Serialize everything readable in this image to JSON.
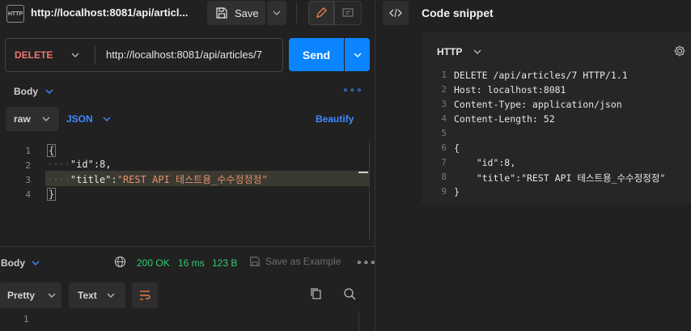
{
  "tab": {
    "title": "http://localhost:8081/api/articl...",
    "icon_text": "HTTP"
  },
  "toolbar": {
    "save_label": "Save"
  },
  "request": {
    "method": "DELETE",
    "url": "http://localhost:8081/api/articles/7",
    "send_label": "Send"
  },
  "body_section": {
    "tab_label": "Body",
    "mode": "raw",
    "format": "JSON",
    "beautify_label": "Beautify",
    "lines": [
      "1",
      "2",
      "3",
      "4"
    ],
    "code": {
      "open": "{",
      "id_key": "\"id\"",
      "id_colon": ":",
      "id_value": "8",
      "id_comma": ",",
      "title_key": "\"title\"",
      "title_colon": ":",
      "title_value": "\"REST API 테스트용_수수정정정\"",
      "close": "}"
    }
  },
  "response": {
    "tab_label": "Body",
    "status": "200 OK",
    "time": "16 ms",
    "size": "123 B",
    "save_example_label": "Save as Example",
    "view_mode": "Pretty",
    "view_type": "Text",
    "line": "1"
  },
  "snippet": {
    "title": "Code snippet",
    "language": "HTTP",
    "line_numbers": [
      "1",
      "2",
      "3",
      "4",
      "5",
      "6",
      "7",
      "8",
      "9"
    ],
    "lines": [
      "DELETE /api/articles/7 HTTP/1.1",
      "Host: localhost:8081",
      "Content-Type: application/json",
      "Content-Length: 52",
      "",
      "{",
      "    \"id\":8,",
      "    \"title\":\"REST API 테스트용_수수정정정\"",
      "}"
    ]
  },
  "colors": {
    "accent": "#0a84ff",
    "method_delete": "#f27474",
    "status_ok": "#2ecc71",
    "string": "#e6906b"
  }
}
